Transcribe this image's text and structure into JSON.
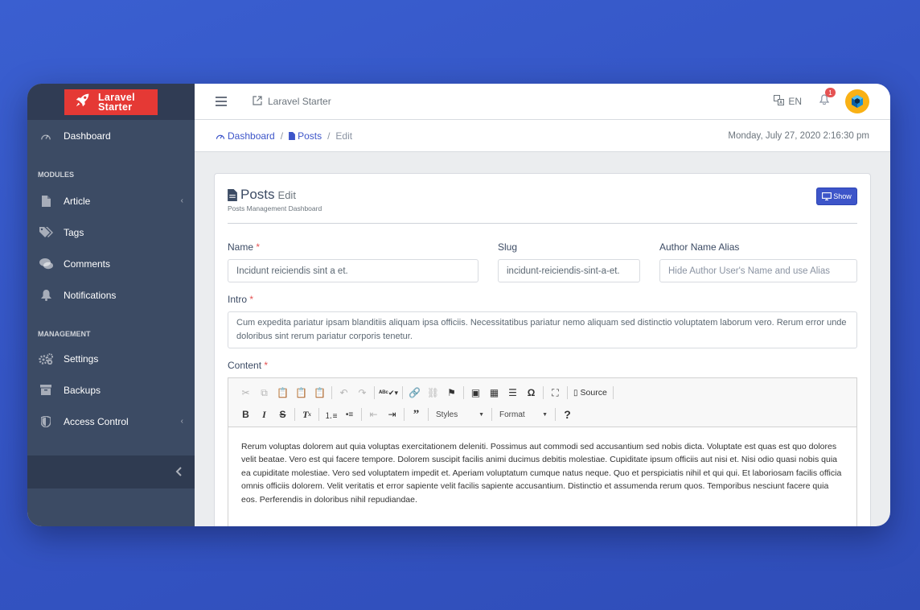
{
  "brand": {
    "line1": "Laravel",
    "line2": "Starter"
  },
  "sidebar": {
    "dashboard": "Dashboard",
    "modules_title": "MODULES",
    "modules": [
      {
        "label": "Article",
        "icon": "file-icon",
        "has_children": true
      },
      {
        "label": "Tags",
        "icon": "tags-icon",
        "has_children": false
      },
      {
        "label": "Comments",
        "icon": "comments-icon",
        "has_children": false
      },
      {
        "label": "Notifications",
        "icon": "bell-icon",
        "has_children": false
      }
    ],
    "management_title": "MANAGEMENT",
    "management": [
      {
        "label": "Settings",
        "icon": "cogs-icon",
        "has_children": false
      },
      {
        "label": "Backups",
        "icon": "archive-icon",
        "has_children": false
      },
      {
        "label": "Access Control",
        "icon": "shield-icon",
        "has_children": true
      }
    ]
  },
  "header": {
    "app_link": "Laravel Starter",
    "language": "EN",
    "notification_count": "1"
  },
  "breadcrumb": {
    "items": [
      "Dashboard",
      "Posts"
    ],
    "active": "Edit",
    "datetime": "Monday, July 27, 2020 2:16:30 pm"
  },
  "card": {
    "title": "Posts",
    "title_sub": "Edit",
    "subtitle": "Posts Management Dashboard",
    "show_button": "Show"
  },
  "form": {
    "name": {
      "label": "Name",
      "value": "Incidunt reiciendis sint a et."
    },
    "slug": {
      "label": "Slug",
      "value": "incidunt-reiciendis-sint-a-et."
    },
    "alias": {
      "label": "Author Name Alias",
      "placeholder": "Hide Author User's Name and use Alias"
    },
    "intro": {
      "label": "Intro",
      "value": "Cum expedita pariatur ipsam blanditiis aliquam ipsa officiis. Necessitatibus pariatur nemo aliquam sed distinctio voluptatem laborum vero. Rerum error unde doloribus sint rerum pariatur corporis tenetur."
    },
    "content": {
      "label": "Content",
      "source_label": "Source",
      "styles_label": "Styles",
      "format_label": "Format",
      "text": "Rerum voluptas dolorem aut quia voluptas exercitationem deleniti. Possimus aut commodi sed accusantium sed nobis dicta. Voluptate est quas est quo dolores velit beatae. Vero est qui facere tempore. Dolorem suscipit facilis animi ducimus debitis molestiae. Cupiditate ipsum officiis aut nisi et. Nisi odio quasi nobis quia ea cupiditate molestiae. Vero sed voluptatem impedit et. Aperiam voluptatum cumque natus neque. Quo et perspiciatis nihil et qui qui. Et laboriosam facilis officia omnis officiis dolorem. Velit veritatis et error sapiente velit facilis sapiente accusantium. Distinctio et assumenda rerum quos. Temporibus nesciunt facere quia eos. Perferendis in doloribus nihil repudiandae."
    }
  },
  "colors": {
    "background": "#3454c4",
    "sidebar": "#3c4b64",
    "brand_red": "#e53935",
    "primary": "#3d55c9",
    "avatar": "#f9b115"
  }
}
